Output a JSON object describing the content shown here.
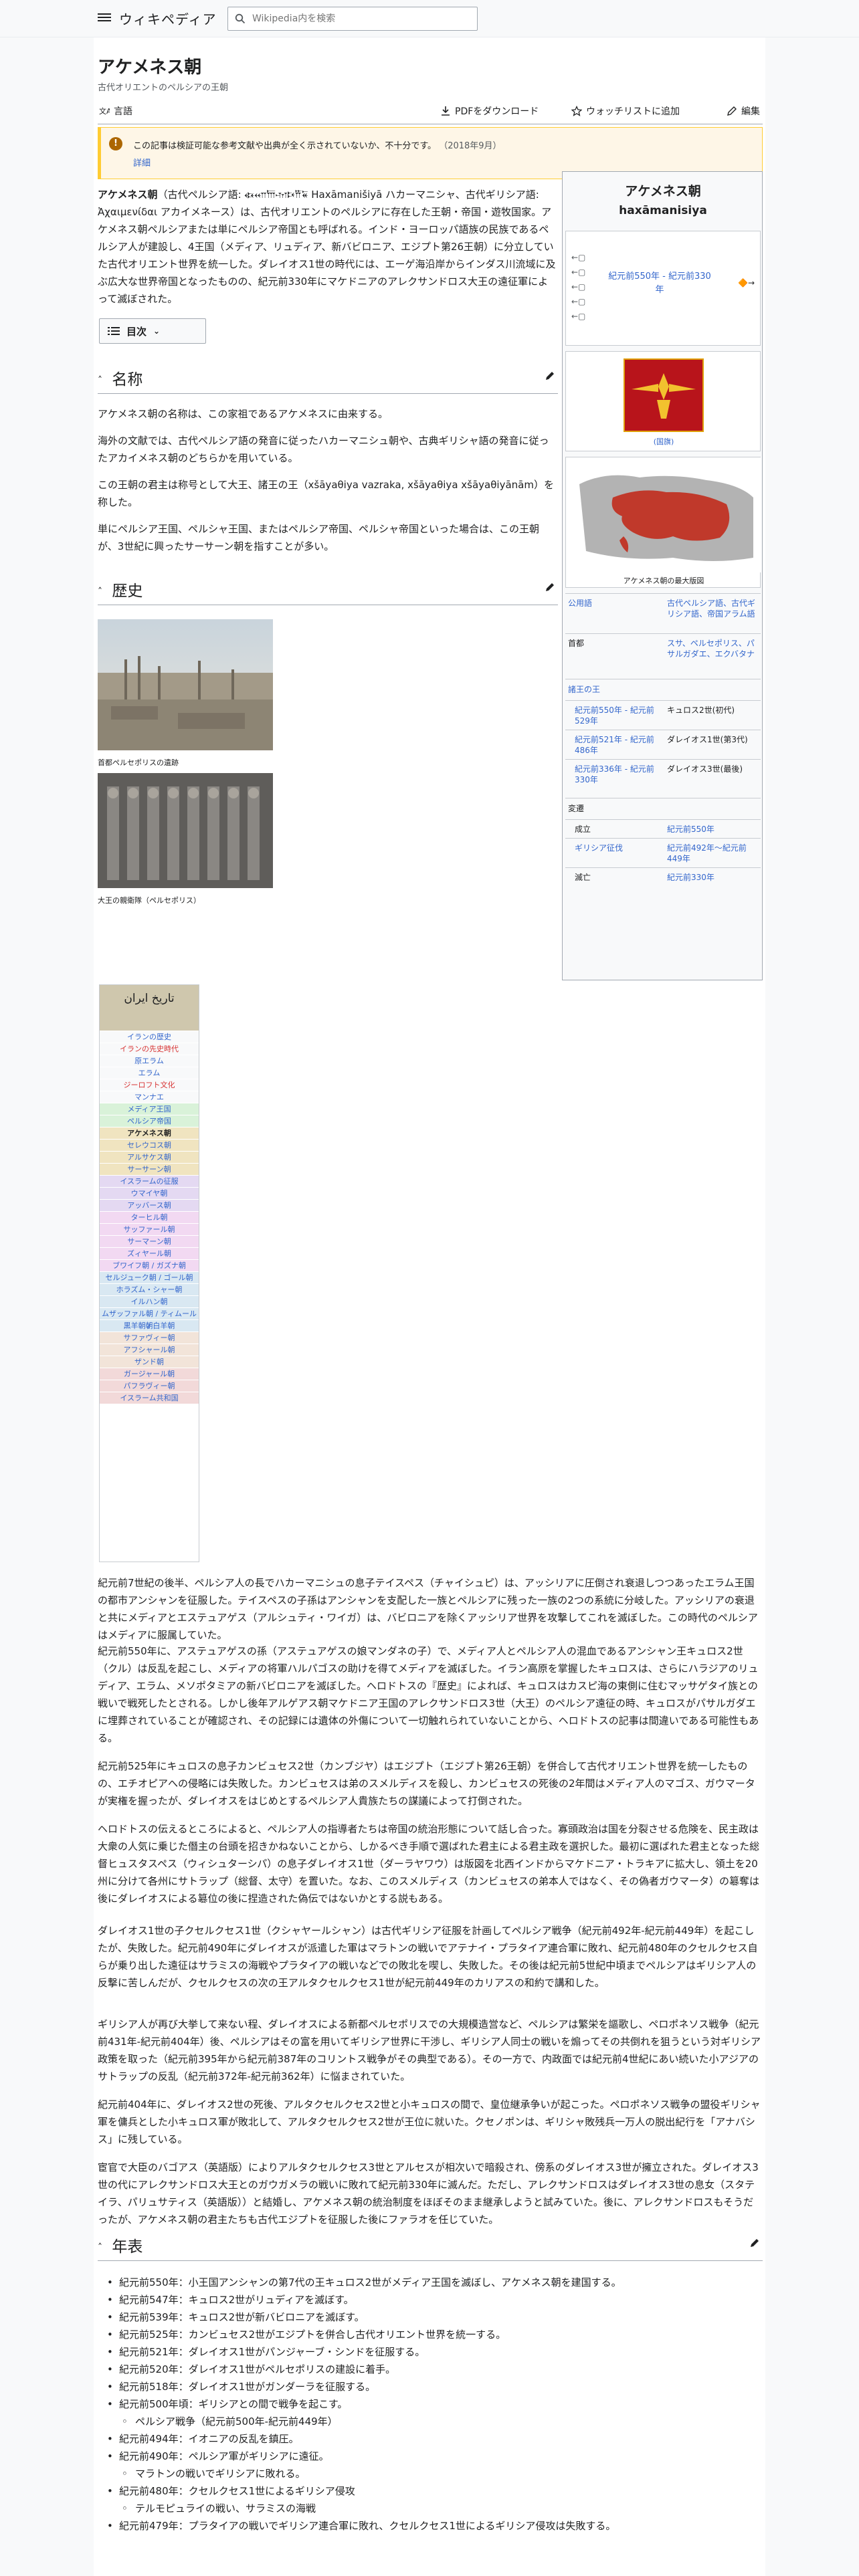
{
  "header": {
    "logo": "ウィキペディア",
    "search_placeholder": "Wikipedia内を検索"
  },
  "page": {
    "title": "アケメネス朝",
    "subtitle": "古代オリエントのペルシアの王朝"
  },
  "toolbar": {
    "languages": "言語",
    "pdf": "PDFをダウンロード",
    "watch": "ウォッチリストに追加",
    "edit": "編集"
  },
  "notice": {
    "text": "この記事は検証可能な参考文献や出典が全く示されていないか、不十分です。",
    "date": "（2018年9月）",
    "more": "詳細"
  },
  "intro": {
    "p1_a": "アケメネス朝",
    "p1_b": "（古代ペルシア語: 𐏃𐎧𐎠𐎶𐎴𐎡𐏁 Haxāmanišiyā ハカーマニシャ、古代ギリシア語: Ἀχαιμενίδαι アカイメネース）は、古代オリエントのペルシアに存在した王朝・帝国・遊牧国家。アケメネス朝ペルシアまたは単にペルシア帝国とも呼ばれる。インド・ヨーロッパ語族の民族であるペルシア人が建設し、4王国（メディア、リュディア、新バビロニア、エジプト第26王朝）に分立していた古代オリエント世界を統一した。ダレイオス1世の時代には、エーゲ海沿岸からインダス川流域に及ぶ広大な世界帝国となったものの、紀元前330年にマケドニアのアレクサンドロス大王の遠征軍によって滅ぼされた。"
  },
  "toc": {
    "label": "目次"
  },
  "sections": {
    "name_h": "名称",
    "name_p1": "アケメネス朝の名称は、この家祖であるアケメネスに由来する。",
    "name_p2": "海外の文献では、古代ペルシア語の発音に従ったハカーマニシュ朝や、古典ギリシャ語の発音に従ったアカイメネス朝のどちらかを用いている。",
    "name_p3": "この王朝の君主は称号として大王、諸王の王（xšāyaθiya vazraka, xšāyaθiya xšāyaθiyānām）を称した。",
    "name_p4": "単にペルシア王国、ペルシャ王国、またはペルシア帝国、ペルシャ帝国といった場合は、この王朝が、3世紀に興ったサーサーン朝を指すことが多い。",
    "history_h": "歴史",
    "img1_cap": "首都ペルセポリスの遺跡",
    "img2_cap": "大王の親衛隊（ペルセポリス）",
    "h_p1": "紀元前7世紀の後半、ペルシア人の長でハカーマニシュの息子テイスペス（チャイシュピ）は、アッシリアに圧倒され衰退しつつあったエラム王国の都市アンシャンを征服した。テイスペスの子孫はアンシャンを支配した一族とペルシアに残った一族の2つの系統に分岐した。アッシリアの衰退と共にメディアとエステュアゲス（アルシュティ・ワイガ）は、バビロニアを除くアッシリア世界を攻撃してこれを滅ぼした。この時代のペルシアはメディアに服属していた。",
    "h_p2": "紀元前550年に、アステュアゲスの孫（アステュアゲスの娘マンダネの子）で、メディア人とペルシア人の混血であるアンシャン王キュロス2世（クル）は反乱を起こし、メディアの将軍ハルパゴスの助けを得てメディアを滅ぼした。イラン高原を掌握したキュロスは、さらにハラジアのリュディア、エラム、メソポタミアの新バビロニアを滅ぼした。ヘロドトスの『歴史』によれば、キュロスはカスピ海の東側に住むマッサゲタイ族との戦いで戦死したとされる。しかし後年アルゲアス朝マケドニア王国のアレクサンドロス3世（大王）のペルシア遠征の時、キュロスがパサルガダエに埋葬されていることが確認され、その記録には遺体の外傷について一切触れられていないことから、ヘロドトスの記事は間違いである可能性もある。",
    "h_p3": "紀元前525年にキュロスの息子カンビュセス2世（カンブジヤ）はエジプト（エジプト第26王朝）を併合して古代オリエント世界を統一したものの、エチオピアへの侵略には失敗した。カンビュセスは弟のスメルディスを殺し、カンビュセスの死後の2年間はメディア人のマゴス、ガウマータが実権を握ったが、ダレイオスをはじめとするペルシア人貴族たちの謀議によって打倒された。",
    "h_p4": "ヘロドトスの伝えるところによると、ペルシア人の指導者たちは帝国の統治形態について話し合った。寡頭政治は国を分裂させる危険を、民主政は大衆の人気に乗じた僭主の台頭を招きかねないことから、しかるべき手順で選ばれた君主による君主政を選択した。最初に選ばれた君主となった総督ヒュスタスペス（ウィシュターシパ）の息子ダレイオス1世（ダーラヤワウ）は版図を北西インドからマケドニア・トラキアに拡大し、領土を20州に分けて各州にサトラップ（総督、太守）を置いた。なお、このスメルディス（カンビュセスの弟本人ではなく、その偽者ガウマータ）の簒奪は後にダレイオスによる簒位の後に捏造された偽伝ではないかとする説もある。",
    "h_p5": "ダレイオス1世の子クセルクセス1世（クシャヤールシャン）は古代ギリシア征服を計画してペルシア戦争（紀元前492年-紀元前449年）を起こしたが、失敗した。紀元前490年にダレイオスが派遣した軍はマラトンの戦いでアテナイ・プラタイア連合軍に敗れ、紀元前480年のクセルクセス自らが乗り出した遠征はサラミスの海戦やプラタイアの戦いなどでの敗北を喫し、失敗した。その後は紀元前5世紀中頃までペルシアはギリシア人の反撃に苦しんだが、クセルクセスの次の王アルタクセルクセス1世が紀元前449年のカリアスの和約で講和した。",
    "h_p6": "ギリシア人が再び大挙して来ない程、ダレイオスによる新都ペルセポリスでの大規模造営など、ペルシアは繁栄を謳歌し、ペロポネソス戦争（紀元前431年-紀元前404年）後、ペルシアはその富を用いてギリシア世界に干渉し、ギリシア人同士の戦いを煽ってその共倒れを狙うという対ギリシア政策を取った（紀元前395年から紀元前387年のコリントス戦争がその典型である）。その一方で、内政面では紀元前4世紀にあい続いた小アジアのサトラップの反乱（紀元前372年-紀元前362年）に悩まされていた。",
    "h_p7": "紀元前404年に、ダレイオス2世の死後、アルタクセルクセス2世と小キュロスの間で、皇位継承争いが起こった。ペロポネソス戦争の盟役ギリシャ軍を傭兵とした小キュロス軍が敗北して、アルタクセルクセス2世が王位に就いた。クセノポンは、ギリシャ敗残兵一万人の脱出紀行を「アナバシス」に残している。",
    "h_p8": "宦官で大臣のバゴアス（英語版）によりアルタクセルクセス3世とアルセスが相次いで暗殺され、傍系のダレイオス3世が擁立された。ダレイオス3世の代にアレクサンドロス大王とのガウガメラの戦いに敗れて紀元前330年に滅んだ。ただし、アレクサンドロスはダレイオス3世の息女（スタテイラ、パリュサティス（英語版））と結婚し、アケメネス朝の統治制度をほぼそのまま継承しようと試みていた。後に、アレクサンドロスもそうだったが、アケメネス朝の君主たちも古代エジプトを征服した後にファラオを任じていた。",
    "chronology_h": "年表"
  },
  "chronology": [
    "紀元前550年：小王国アンシャンの第7代の王キュロス2世がメディア王国を滅ぼし、アケメネス朝を建国する。",
    "紀元前547年：キュロス2世がリュディアを滅ぼす。",
    "紀元前539年：キュロス2世が新バビロニアを滅ぼす。",
    "紀元前525年：カンビュセス2世がエジプトを併合し古代オリエント世界を統一する。",
    "紀元前521年：ダレイオス1世がパンジャーブ・シンドを征服する。",
    "紀元前520年：ダレイオス1世がペルセポリスの建設に着手。",
    "紀元前518年：ダレイオス1世がガンダーラを征服する。",
    "紀元前500年頃：ギリシアとの間で戦争を起こす。",
    "ペルシア戦争（紀元前500年-紀元前449年）",
    "紀元前494年：イオニアの反乱を鎮圧。",
    "紀元前490年：ペルシア軍がギリシアに遠征。",
    "マラトンの戦いでギリシアに敗れる。",
    "紀元前480年：クセルクセス1世によるギリシア侵攻",
    "テルモピュライの戦い、サラミスの海戦",
    "紀元前479年：プラタイアの戦いでギリシア連合軍に敗れ、クセルクセス1世によるギリシア侵攻は失敗する。"
  ],
  "infobox": {
    "title": "アケメネス朝",
    "subtitle": "haxāmanisiya",
    "period": "紀元前550年 - 紀元前330年",
    "flag_caption": "(国旗)",
    "map_caption": "アケメネス朝の最大版図",
    "rows": [
      {
        "label": "公用語",
        "value": "古代ペルシア語、古代ギリシア語、帝国アラム語"
      },
      {
        "label": "首都",
        "value": "スサ、ペルセポリス、パサルガダエ、エクバタナ"
      }
    ],
    "kings_head": "諸王の王",
    "kings": [
      {
        "period": "紀元前550年 - 紀元前529年",
        "name": "キュロス2世(初代)"
      },
      {
        "period": "紀元前521年 - 紀元前486年",
        "name": "ダレイオス1世(第3代)"
      },
      {
        "period": "紀元前336年 - 紀元前330年",
        "name": "ダレイオス3世(最後)"
      }
    ],
    "changes_head": "変遷",
    "changes": [
      {
        "event": "成立",
        "date": "紀元前550年"
      },
      {
        "event": "ギリシア征伐",
        "date": "紀元前492年〜紀元前449年"
      },
      {
        "event": "滅亡",
        "date": "紀元前330年"
      }
    ]
  },
  "navbox": {
    "head": "تاريخ ايران",
    "items": [
      {
        "label": "イランの歴史",
        "color": "#f8f9fa",
        "link": true
      },
      {
        "label": "イランの先史時代",
        "color": "#f8f9fa",
        "link": true,
        "red": true
      },
      {
        "label": "原エラム",
        "color": "#f8f9fa",
        "link": true
      },
      {
        "label": "エラム",
        "color": "#f8f9fa",
        "link": true
      },
      {
        "label": "ジーロフト文化",
        "color": "#f8f9fa",
        "link": true,
        "red": true
      },
      {
        "label": "マンナエ",
        "color": "#f8f9fa",
        "link": true
      },
      {
        "label": "メディア王国",
        "color": "#d9f2d9",
        "link": true
      },
      {
        "label": "ペルシア帝国",
        "color": "#d9f2d9",
        "link": true
      },
      {
        "label": "アケメネス朝",
        "color": "#f0e4c0",
        "link": false
      },
      {
        "label": "セレウコス朝",
        "color": "#f0e4c0",
        "link": true
      },
      {
        "label": "アルサケス朝",
        "color": "#f0e4c0",
        "link": true
      },
      {
        "label": "サーサーン朝",
        "color": "#f0e4c0",
        "link": true
      },
      {
        "label": "イスラームの征服",
        "color": "#e4d9f2",
        "link": true
      },
      {
        "label": "ウマイヤ朝",
        "color": "#e4d9f2",
        "link": true
      },
      {
        "label": "アッバース朝",
        "color": "#e4d9f2",
        "link": true
      },
      {
        "label": "ターヒル朝",
        "color": "#f2d9f2",
        "link": true
      },
      {
        "label": "サッファール朝",
        "color": "#f2d9f2",
        "link": true
      },
      {
        "label": "サーマーン朝",
        "color": "#f2d9f2",
        "link": true
      },
      {
        "label": "ズィヤール朝",
        "color": "#f2d9f2",
        "link": true
      },
      {
        "label": "ブワイフ朝 / ガズナ朝",
        "color": "#f2d9f2",
        "link": true
      },
      {
        "label": "セルジューク朝 / ゴール朝",
        "color": "#d9e8f2",
        "link": true
      },
      {
        "label": "ホラズム・シャー朝",
        "color": "#d9e8f2",
        "link": true
      },
      {
        "label": "イルハン朝",
        "color": "#d9e8f2",
        "link": true
      },
      {
        "label": "ムザッファル朝 / ティムール朝",
        "color": "#d9e8f2",
        "link": true
      },
      {
        "label": "黒羊朝 / 白羊朝",
        "color": "#d9e8f2",
        "link": true
      },
      {
        "label": "サファヴィー朝",
        "color": "#f2e4d9",
        "link": true
      },
      {
        "label": "アフシャール朝",
        "color": "#f2e4d9",
        "link": true
      },
      {
        "label": "ザンド朝",
        "color": "#f2e4d9",
        "link": true
      },
      {
        "label": "ガージャール朝",
        "color": "#f2d9d9",
        "link": true
      },
      {
        "label": "パフラヴィー朝",
        "color": "#f2d9d9",
        "link": true
      },
      {
        "label": "イスラーム共和国",
        "color": "#f2d9d9",
        "link": true
      }
    ]
  }
}
